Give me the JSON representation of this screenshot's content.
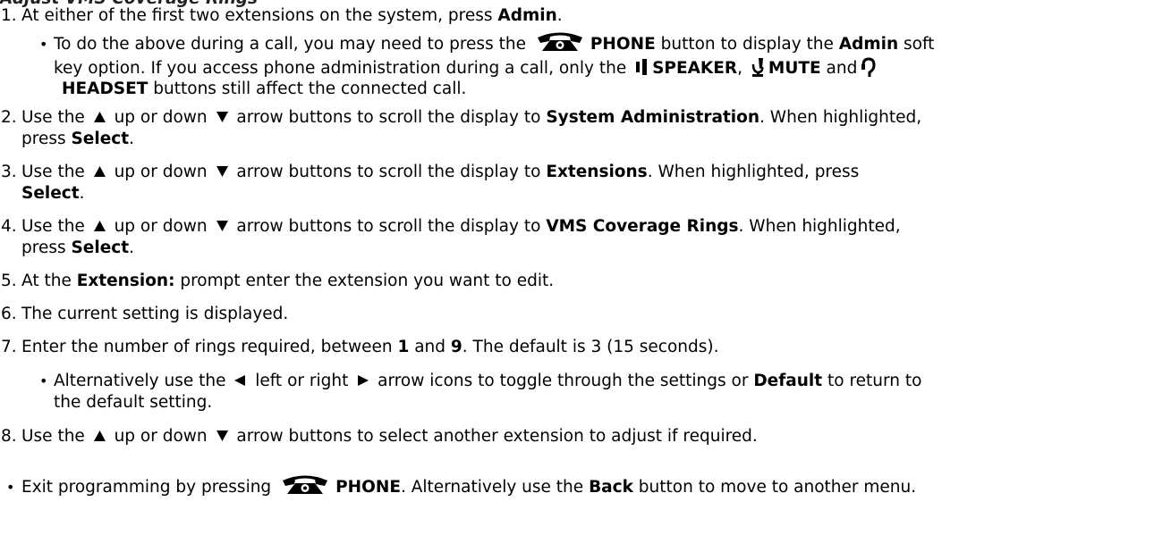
{
  "top_cut": "Adjust VMS Coverage Rings",
  "steps": [
    {
      "num": "1.",
      "a": "At either of the first two extensions on the system, press ",
      "b1": "Admin",
      "c": "."
    },
    {
      "num": "2.",
      "a": "Use the ",
      "up": " up or down ",
      "b": " arrow buttons to scroll the display to ",
      "bold": "System Administration",
      "c": ". When highlighted,",
      "cont_b": "press ",
      "cont_bold": "Select",
      "cont_c": "."
    },
    {
      "num": "3.",
      "a": "Use the ",
      "up": " up or down ",
      "b": " arrow buttons to scroll the display to ",
      "bold": "Extensions",
      "c": ". When highlighted, press",
      "cont_bold": "Select",
      "cont_c": "."
    },
    {
      "num": "4.",
      "a": "Use the ",
      "up": " up or down ",
      "b": " arrow buttons to scroll the display to ",
      "bold": "VMS Coverage Rings",
      "c": ". When highlighted,",
      "cont_b": "press ",
      "cont_bold": "Select",
      "cont_c": "."
    },
    {
      "num": "5.",
      "a": "At the ",
      "bold": "Extension:",
      "c": " prompt enter the extension you want to edit."
    },
    {
      "num": "6.",
      "a": "The current setting is displayed."
    },
    {
      "num": "7.",
      "a": "Enter the number of rings required, between ",
      "bold1": "1",
      "mid": " and ",
      "bold2": "9",
      "c": ". The default is 3 (15 seconds)."
    },
    {
      "num": "8.",
      "a": "Use the ",
      "up": " up or down ",
      "b": " arrow buttons to select another extension to adjust if required."
    }
  ],
  "sub1": {
    "a": "To do the above during a call, you may need to press the ",
    "phone": "PHONE",
    "b": " button to display the ",
    "admin": "Admin",
    "c": " soft",
    "l2a": "key option. If you access phone administration during a call, only the ",
    "speaker": "SPEAKER",
    "l2b": ", ",
    "mute": "MUTE",
    "l2c": " and",
    "headset": "HEADSET",
    "l3": " buttons still affect the connected call."
  },
  "sub7": {
    "a": "Alternatively use the ",
    "left": " left or right ",
    "b": " arrow icons to toggle through the settings or ",
    "bold": "Default",
    "c": " to return to",
    "l2": "the default setting."
  },
  "final": {
    "a": "Exit programming by pressing ",
    "phone": "PHONE",
    "b": ". Alternatively use the ",
    "back": "Back",
    "c": " button to move to another menu."
  },
  "colors": {
    "text": "#000000",
    "background": "#ffffff"
  },
  "icons": [
    "phone-icon",
    "speaker-icon",
    "mute-icon",
    "headset-icon",
    "up-arrow-icon",
    "down-arrow-icon",
    "left-arrow-icon",
    "right-arrow-icon"
  ]
}
